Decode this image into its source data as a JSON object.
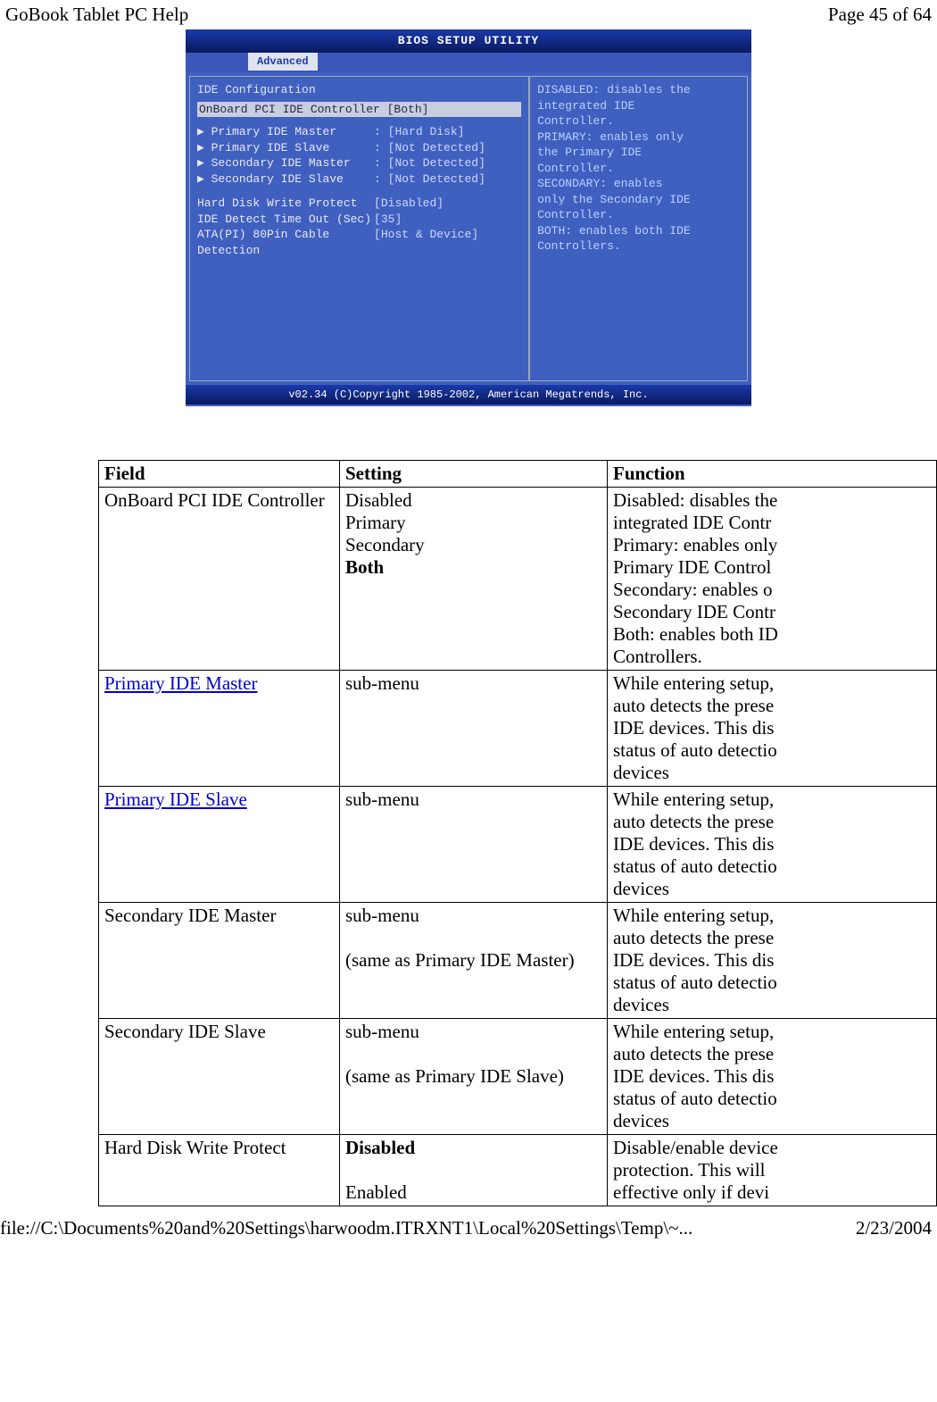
{
  "header": {
    "doc_title": "GoBook Tablet PC Help",
    "page_label": "Page 45 of 64"
  },
  "bios": {
    "title": "BIOS SETUP UTILITY",
    "tab": "Advanced",
    "section": "IDE Configuration",
    "highlight_row": "OnBoard PCI IDE Controller     [Both]",
    "rows": [
      {
        "k": "▶ Primary IDE Master",
        "v": ": [Hard Disk]"
      },
      {
        "k": "▶ Primary IDE Slave",
        "v": ": [Not Detected]"
      },
      {
        "k": "▶ Secondary IDE Master",
        "v": ": [Not Detected]"
      },
      {
        "k": "▶ Secondary IDE Slave",
        "v": ": [Not Detected]"
      }
    ],
    "rows2": [
      {
        "k": "Hard Disk Write Protect",
        "v": "[Disabled]"
      },
      {
        "k": "IDE Detect Time Out (Sec)",
        "v": "[35]"
      },
      {
        "k": "ATA(PI) 80Pin Cable Detection",
        "v": "[Host & Device]"
      }
    ],
    "help_lines": [
      "DISABLED: disables the",
      "integrated IDE",
      "Controller.",
      "PRIMARY: enables only",
      "the Primary IDE",
      "Controller.",
      "SECONDARY: enables",
      "only the Secondary IDE",
      "Controller.",
      "BOTH: enables both IDE",
      "Controllers."
    ],
    "footer": "v02.34 (C)Copyright 1985-2002, American Megatrends, Inc."
  },
  "table": {
    "headers": {
      "field": "Field",
      "setting": "Setting",
      "function": "Function"
    },
    "rows": [
      {
        "field": "OnBoard PCI IDE Controller",
        "field_link": false,
        "setting_lines": [
          "Disabled",
          "Primary",
          "Secondary"
        ],
        "setting_bold": "Both",
        "setting_after": [],
        "function": "Disabled: disables the\nintegrated IDE Contr\nPrimary: enables only\nPrimary IDE Control\nSecondary: enables o\nSecondary IDE Contr\nBoth: enables both ID\nControllers."
      },
      {
        "field": "Primary IDE Master",
        "field_link": true,
        "setting_lines": [
          "sub-menu"
        ],
        "setting_bold": "",
        "setting_after": [],
        "function": "While entering setup,\nauto detects the prese\nIDE devices. This dis\nstatus of auto detectio\ndevices"
      },
      {
        "field": "Primary IDE Slave",
        "field_link": true,
        "setting_lines": [
          "sub-menu"
        ],
        "setting_bold": "",
        "setting_after": [],
        "function": "While entering setup,\nauto detects the prese\nIDE devices. This dis\nstatus of auto detectio\ndevices"
      },
      {
        "field": "Secondary IDE Master",
        "field_link": false,
        "setting_lines": [
          "sub-menu",
          "",
          "(same as Primary IDE Master)"
        ],
        "setting_bold": "",
        "setting_after": [],
        "function": "While entering setup,\nauto detects the prese\nIDE devices. This dis\nstatus of auto detectio\ndevices"
      },
      {
        "field": "Secondary IDE Slave",
        "field_link": false,
        "setting_lines": [
          "sub-menu",
          "",
          "(same as Primary IDE Slave)"
        ],
        "setting_bold": "",
        "setting_after": [],
        "function": "While entering setup,\nauto detects the prese\nIDE devices. This dis\nstatus of auto detectio\ndevices"
      },
      {
        "field": "Hard Disk Write Protect",
        "field_link": false,
        "setting_lines": [],
        "setting_bold": "Disabled",
        "setting_after": [
          "",
          "Enabled"
        ],
        "function": "Disable/enable device\nprotection. This will\neffective only if devi"
      }
    ]
  },
  "footer": {
    "path": "file://C:\\Documents%20and%20Settings\\harwoodm.ITRXNT1\\Local%20Settings\\Temp\\~...",
    "date": "2/23/2004"
  }
}
